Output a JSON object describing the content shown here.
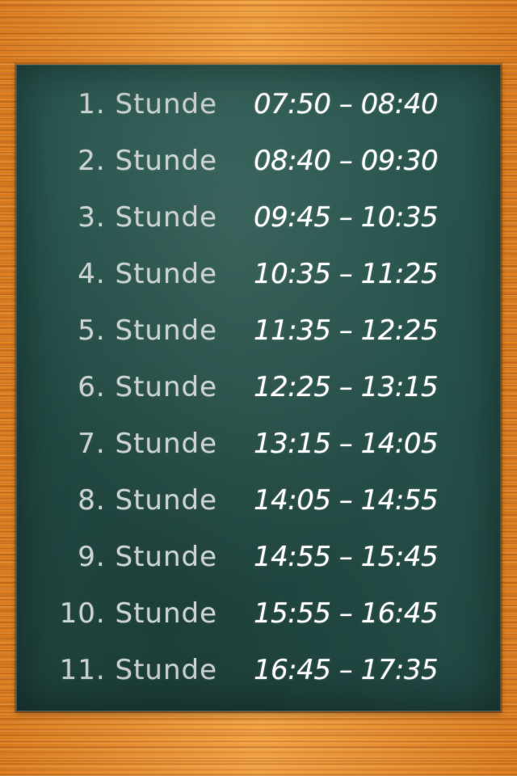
{
  "schedule": {
    "periods": [
      {
        "label": "1. Stunde",
        "time": "07:50 – 08:40"
      },
      {
        "label": "2. Stunde",
        "time": "08:40 – 09:30"
      },
      {
        "label": "3. Stunde",
        "time": "09:45 – 10:35"
      },
      {
        "label": "4. Stunde",
        "time": "10:35 – 11:25"
      },
      {
        "label": "5. Stunde",
        "time": "11:35 – 12:25"
      },
      {
        "label": "6. Stunde",
        "time": "12:25 – 13:15"
      },
      {
        "label": "7. Stunde",
        "time": "13:15 – 14:05"
      },
      {
        "label": "8. Stunde",
        "time": "14:05 – 14:55"
      },
      {
        "label": "9. Stunde",
        "time": "14:55 – 15:45"
      },
      {
        "label": "10. Stunde",
        "time": "15:55 – 16:45"
      },
      {
        "label": "11. Stunde",
        "time": "16:45 – 17:35"
      }
    ]
  },
  "colors": {
    "board": "#27514b",
    "wood": "#e8902e",
    "label_text": "#c8d1cf",
    "time_text": "#ffffff"
  }
}
